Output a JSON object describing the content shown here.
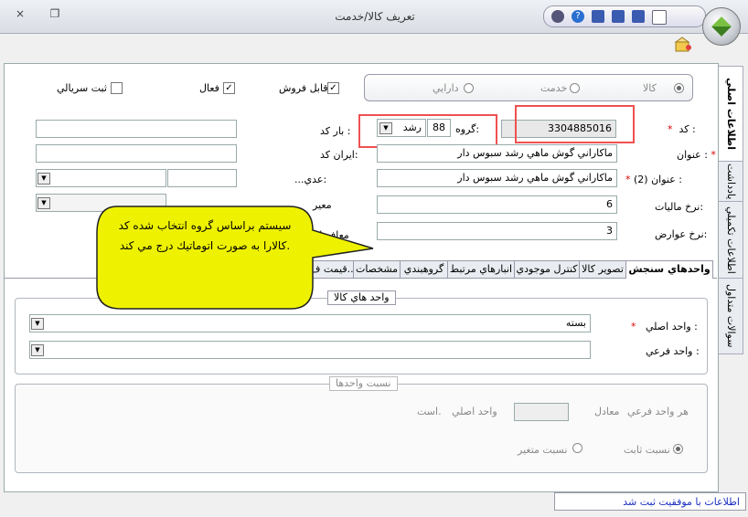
{
  "window": {
    "title": "تعريف كالا/خدمت",
    "close": "×",
    "restore": "❐"
  },
  "type_group": {
    "options": [
      "كالا",
      "خدمت",
      "دارايي"
    ]
  },
  "flags": {
    "serial": "ثبت سريالي",
    "active": "فعال",
    "sellable": "قابل فروش"
  },
  "fields": {
    "code_label": "كد :",
    "code_value": "3304885016",
    "group_label": "گروه:",
    "group_number": "88",
    "group_name": "رشد",
    "barcode_label": "بار كد :",
    "irancode_label": "ايران كد:",
    "title_label": "عنوان :",
    "title_value": "ماكاراني گوش ماهي رشد سبوس دار",
    "title2_label": "عنوان (2) :",
    "title2_value": "ماكاراني گوش ماهي رشد سبوس دار",
    "tax_label": "نرخ ماليات:",
    "tax_value": "6",
    "duty_label": "نرخ عوارض:",
    "duty_value": "3",
    "partial_label_1": "...عدي:",
    "partial_label_2": "معير",
    "partial_label_3": "معاف از",
    "required_mark": "*"
  },
  "side_tabs": [
    "اطلاعات اصلي",
    "يادداشت",
    "اطلاعات تكميلي",
    "سوالات متداول"
  ],
  "tabs": [
    "واحدهاي سنجش",
    "تصوير كالا",
    "كنترل موجودي",
    "انبارهاي مرتبط",
    "گروهبندي",
    "مشخصات",
    "قيمت ف..."
  ],
  "units_group": {
    "title": "واحد هاي كالا",
    "main_unit_label": "واحد اصلي :",
    "main_unit_value": "بسته",
    "sub_unit_label": "واحد فرعي :"
  },
  "ratio_group": {
    "title": "نسبت واحدها",
    "text_each_sub": "هر واحد فرعي",
    "text_equals": "معادل",
    "text_main_unit": "واحد اصلي",
    "text_is": "است.",
    "fixed_label": "نسبت ثابت",
    "variable_label": "نسبت متغير"
  },
  "callout": {
    "text": "سيستم براساس گروه انتخاب شده كد كالارا به صورت اتوماتيك درج مي كند."
  },
  "status": {
    "message": "اطلاعات با موفقيت ثبت شد"
  },
  "colors": {
    "callout_fill": "#eef200",
    "highlight": "#f05050",
    "status_text": "#1b2fbf"
  }
}
